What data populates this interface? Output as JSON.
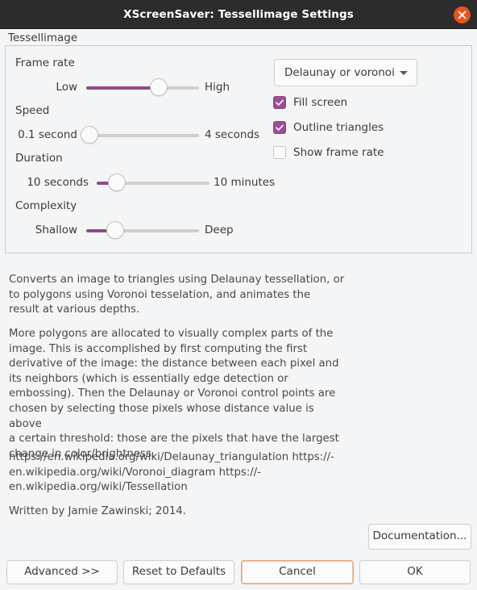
{
  "window": {
    "title": "XScreenSaver: Tessellimage Settings",
    "close_icon": "close-icon",
    "close_color": "#e9521c",
    "titlebar_color": "#2c2c2c",
    "background_color": "#f4f5f6",
    "accent_color": "#8f4b86",
    "focus_color": "#e9a47e"
  },
  "group": {
    "label": "Tessellimage"
  },
  "sliders": [
    {
      "title": "Frame rate",
      "min_label": "Low",
      "max_label": "High",
      "value_pct": 64
    },
    {
      "title": "Speed",
      "min_label": "0.1 second",
      "max_label": "4 seconds",
      "value_pct": 3
    },
    {
      "title": "Duration",
      "min_label": "10 seconds",
      "max_label": "10 minutes",
      "value_pct": 18
    },
    {
      "title": "Complexity",
      "min_label": "Shallow",
      "max_label": "Deep",
      "value_pct": 26
    }
  ],
  "dropdown": {
    "selected": "Delaunay or voronoi",
    "arrow_icon": "chevron-down-icon"
  },
  "checkboxes": [
    {
      "label": "Fill screen",
      "checked": true
    },
    {
      "label": "Outline triangles",
      "checked": true
    },
    {
      "label": "Show frame rate",
      "checked": false
    }
  ],
  "description": {
    "paragraph1": "Converts an image to triangles using Delaunay tessellation, or\nto polygons using Voronoi tesselation, and animates the\nresult at various depths.",
    "paragraph2": "More polygons are allocated to visually complex parts of the\nimage. This is accomplished by first computing the first\nderivative of the image: the distance between each pixel and\nits neighbors (which is essentially edge detection or\nembossing). Then the Delaunay or Voronoi control points are\nchosen by selecting those pixels whose distance value is above\na certain threshold: those are the pixels that have the largest\nchange in color/brightness.",
    "paragraph3": "https://en.wikipedia.org/wiki/Delaunay_triangulation https://-\nen.wikipedia.org/wiki/Voronoi_diagram https://-\nen.wikipedia.org/wiki/Tessellation",
    "paragraph4": "Written by Jamie Zawinski; 2014."
  },
  "buttons": {
    "documentation": "Documentation...",
    "advanced": "Advanced >>",
    "reset": "Reset to Defaults",
    "cancel": "Cancel",
    "ok": "OK"
  }
}
